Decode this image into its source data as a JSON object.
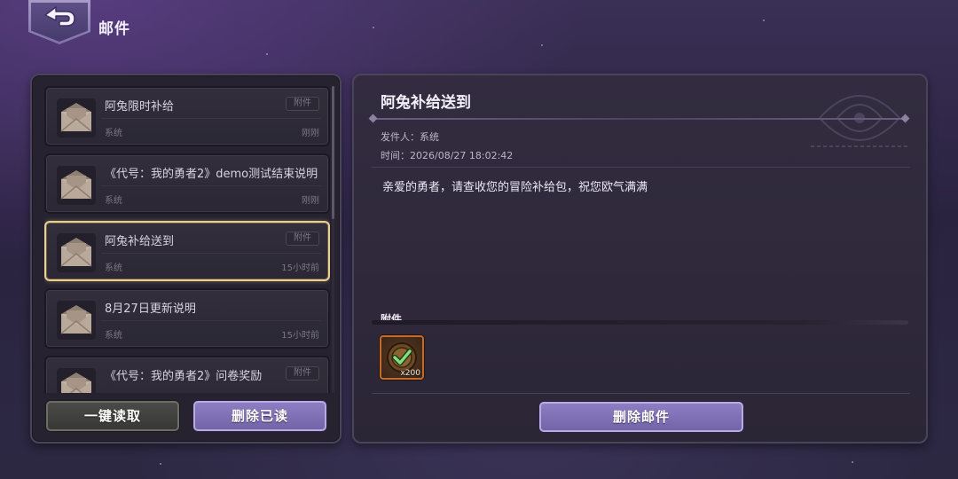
{
  "header": {
    "back_icon": "back-arrow-icon",
    "title": "邮件"
  },
  "mail_list": {
    "items": [
      {
        "title": "阿兔限时补给",
        "sender": "系统",
        "time": "刚刚",
        "attachment_tag": "附件",
        "has_attachment": true,
        "selected": false
      },
      {
        "title": "《代号：我的勇者2》demo测试结束说明",
        "sender": "系统",
        "time": "刚刚",
        "attachment_tag": "",
        "has_attachment": false,
        "selected": false
      },
      {
        "title": "阿兔补给送到",
        "sender": "系统",
        "time": "15小时前",
        "attachment_tag": "附件",
        "has_attachment": true,
        "selected": true
      },
      {
        "title": "8月27日更新说明",
        "sender": "系统",
        "time": "15小时前",
        "attachment_tag": "",
        "has_attachment": false,
        "selected": false
      },
      {
        "title": "《代号：我的勇者2》问卷奖励",
        "sender": "",
        "time": "",
        "attachment_tag": "附件",
        "has_attachment": true,
        "selected": false
      }
    ],
    "read_all_label": "一键读取",
    "delete_read_label": "删除已读"
  },
  "detail": {
    "title": "阿兔补给送到",
    "sender_line": "发件人：系统",
    "time_line": "时间：2026/08/27 18:02:42",
    "body": "亲爱的勇者，请查收您的冒险补给包，祝您欧气满满",
    "attachments_label": "附件",
    "attachments": [
      {
        "icon": "check-coin-icon",
        "quantity": "x200"
      }
    ],
    "delete_label": "删除邮件"
  },
  "colors": {
    "selected_border": "#e8cf94",
    "button_purple": "#7f70b6",
    "item_frame": "#c46a2c"
  }
}
